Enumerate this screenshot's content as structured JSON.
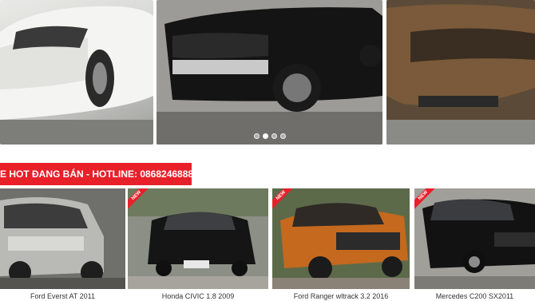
{
  "slider": {
    "slides": [
      {
        "icon": "white-suv-photo"
      },
      {
        "icon": "black-suv-photo"
      },
      {
        "icon": "bronze-suv-photo"
      }
    ],
    "active_index": 1,
    "dot_count": 4
  },
  "hot_banner": {
    "text": "E HOT ĐANG BÁN - HOTLINE: 0868246888"
  },
  "cards": [
    {
      "title": "Ford Everst AT 2011",
      "ribbon": "",
      "icon": "silver-suv-photo"
    },
    {
      "title": "Honda CIVIC 1.8 2009",
      "ribbon": "NEW",
      "icon": "black-sedan-photo"
    },
    {
      "title": "Ford Ranger wltrack 3.2 2016",
      "ribbon": "NEW",
      "icon": "orange-pickup-photo"
    },
    {
      "title": "Mercedes C200 SX2011",
      "ribbon": "NEW",
      "icon": "black-mercedes-photo"
    }
  ],
  "colors": {
    "accent": "#e8202a",
    "text": "#333333"
  }
}
